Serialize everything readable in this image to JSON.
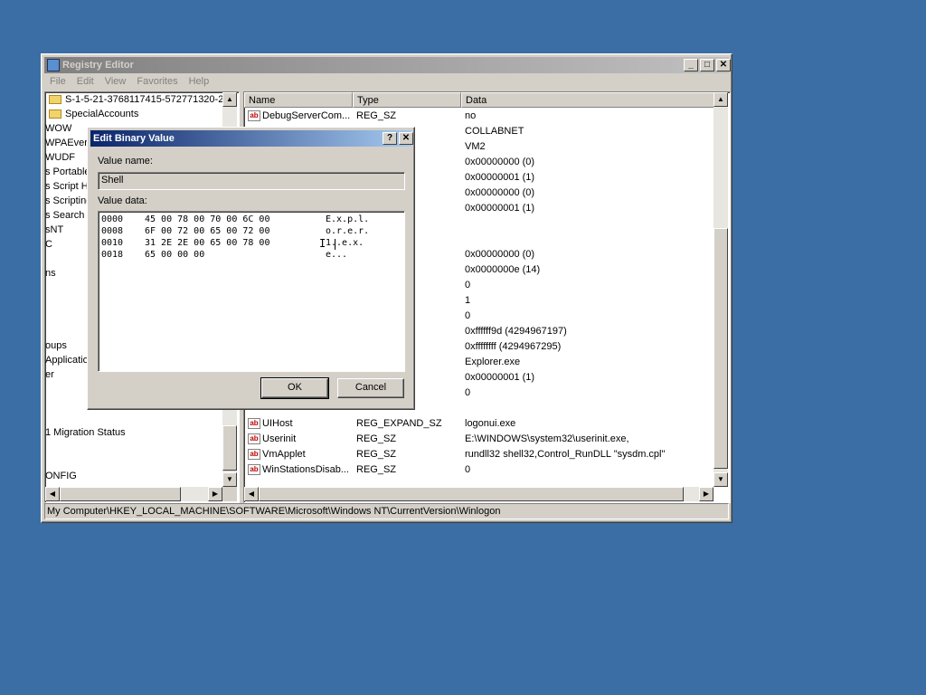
{
  "window": {
    "title": "Registry Editor",
    "minimize": "_",
    "maximize": "□",
    "close": "✕"
  },
  "menu": [
    "File",
    "Edit",
    "View",
    "Favorites",
    "Help"
  ],
  "tree": {
    "items": [
      {
        "label": "S-1-5-21-3768117415-572771320-2",
        "folder": true
      },
      {
        "label": "SpecialAccounts",
        "folder": true
      },
      {
        "label": "WOW",
        "folder": false
      },
      {
        "label": "WPAEver",
        "folder": false
      },
      {
        "label": "WUDF",
        "folder": false
      },
      {
        "label": "s Portable",
        "folder": false
      },
      {
        "label": "s Script H",
        "folder": false
      },
      {
        "label": "s Scripting",
        "folder": false
      },
      {
        "label": "s Search",
        "folder": false
      },
      {
        "label": "sNT",
        "folder": false
      },
      {
        "label": "C",
        "folder": false
      },
      {
        "label": "ns",
        "folder": false
      },
      {
        "label": "oups",
        "folder": false
      },
      {
        "label": "Application",
        "folder": false
      },
      {
        "label": "er",
        "folder": false
      },
      {
        "label": "1 Migration Status",
        "folder": false
      },
      {
        "label": "ONFIG",
        "folder": false
      }
    ]
  },
  "list": {
    "columns": [
      "Name",
      "Type",
      "Data"
    ],
    "rows": [
      {
        "name": "DebugServerCom...",
        "type": "REG_SZ",
        "data": "no"
      },
      {
        "name": "",
        "type": "",
        "data": "COLLABNET"
      },
      {
        "name": "",
        "type": "",
        "data": "VM2"
      },
      {
        "name": "",
        "type": "",
        "data": "0x00000000 (0)"
      },
      {
        "name": "",
        "type": "",
        "data": "0x00000001 (1)"
      },
      {
        "name": "",
        "type": "",
        "data": "0x00000000 (0)"
      },
      {
        "name": "",
        "type": "",
        "data": "0x00000001 (1)"
      },
      {
        "name": "",
        "type": "",
        "data": ""
      },
      {
        "name": "",
        "type": "",
        "data": ""
      },
      {
        "name": "",
        "type": "",
        "data": "0x00000000 (0)"
      },
      {
        "name": "",
        "type": "",
        "data": "0x0000000e (14)"
      },
      {
        "name": "",
        "type": "",
        "data": "0"
      },
      {
        "name": "",
        "type": "",
        "data": "1"
      },
      {
        "name": "",
        "type": "",
        "data": "0"
      },
      {
        "name": "",
        "type": "",
        "data": "0xffffff9d (4294967197)"
      },
      {
        "name": "",
        "type": "",
        "data": "0xffffffff (4294967295)"
      },
      {
        "name": "",
        "type": "",
        "data": "Explorer.exe"
      },
      {
        "name": "",
        "type": "",
        "data": "0x00000001 (1)"
      },
      {
        "name": "",
        "type": "",
        "data": "0"
      },
      {
        "name": "",
        "type": "",
        "data": ""
      },
      {
        "name": "UIHost",
        "type": "REG_EXPAND_SZ",
        "data": "logonui.exe"
      },
      {
        "name": "Userinit",
        "type": "REG_SZ",
        "data": "E:\\WINDOWS\\system32\\userinit.exe,"
      },
      {
        "name": "VmApplet",
        "type": "REG_SZ",
        "data": "rundll32 shell32,Control_RunDLL \"sysdm.cpl\""
      },
      {
        "name": "WinStationsDisab...",
        "type": "REG_SZ",
        "data": "0"
      }
    ]
  },
  "statusbar": "My Computer\\HKEY_LOCAL_MACHINE\\SOFTWARE\\Microsoft\\Windows NT\\CurrentVersion\\Winlogon",
  "dialog": {
    "title": "Edit Binary Value",
    "help": "?",
    "close": "✕",
    "value_name_label": "Value name:",
    "value_name": "Shell",
    "value_data_label": "Value data:",
    "hex_lines": [
      {
        "offset": "0000",
        "hex": "45 00 78 00 70 00 6C 00",
        "ascii": "E.x.p.l."
      },
      {
        "offset": "0008",
        "hex": "6F 00 72 00 65 00 72 00",
        "ascii": "o.r.e.r."
      },
      {
        "offset": "0010",
        "hex": "31 2E 2E 00 65 00 78 00",
        "ascii": "1..e.x."
      },
      {
        "offset": "0018",
        "hex": "65 00 00 00",
        "ascii": "e..."
      }
    ],
    "ok": "OK",
    "cancel": "Cancel"
  }
}
